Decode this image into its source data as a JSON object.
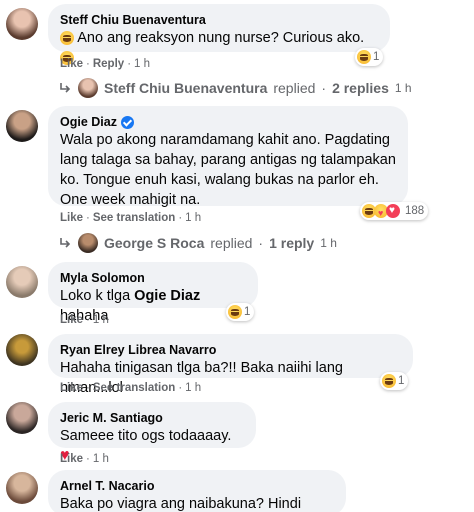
{
  "comments": [
    {
      "name": "Steff Chiu Buenaventura",
      "text": "Ano ang reaksyon nung nurse? Curious ako.",
      "actions": [
        "Like",
        "Reply"
      ],
      "time": "1 h",
      "reaction_count": "1",
      "replies": {
        "name": "Steff Chiu Buenaventura",
        "label": "replied",
        "count": "2 replies",
        "time": "1 h"
      }
    },
    {
      "name": "Ogie Diaz",
      "verified": true,
      "text": "Wala po akong naramdamang kahit ano. Pagdating lang talaga sa bahay, parang antigas ng talampakan ko. Tongue enuh kasi, walang bukas na parlor eh. One week mahigit na.",
      "actions": [
        "Like",
        "See translation"
      ],
      "time": "1 h",
      "reaction_count": "188",
      "replies": {
        "name": "George S Roca",
        "label": "replied",
        "count": "1 reply",
        "time": "1 h"
      }
    },
    {
      "name": "Myla Solomon",
      "text_prefix": "Loko k tlga ",
      "text_mention": "Ogie Diaz",
      "text_suffix": " hahaha",
      "actions": [
        "Like"
      ],
      "time": "1 h",
      "reaction_count": "1"
    },
    {
      "name": "Ryan Elrey Librea Navarro",
      "text": "Hahaha tinigasan tlga ba?!! Baka naiihi lang nman...lol",
      "actions": [
        "Like",
        "See translation"
      ],
      "time": "1 h",
      "reaction_count": "1"
    },
    {
      "name": "Jeric M. Santiago",
      "text": "Sameee tito ogs todaaaay.",
      "actions": [
        "Like"
      ],
      "time": "1 h"
    },
    {
      "name": "Arnel T. Nacario",
      "text": "Baka po viagra ang naibakuna? Hindi kaya?"
    }
  ],
  "icons": {
    "reply_arrow": "reply-arrow-icon",
    "verified": "verified-badge-icon",
    "haha": "haha-reaction-icon",
    "love": "love-reaction-icon",
    "care": "care-reaction-icon",
    "heart": "heart-emoji"
  },
  "colors": {
    "bubble": "#f0f2f5",
    "muted": "#65676b",
    "verified": "#1877f2",
    "love": "#f33e58"
  }
}
